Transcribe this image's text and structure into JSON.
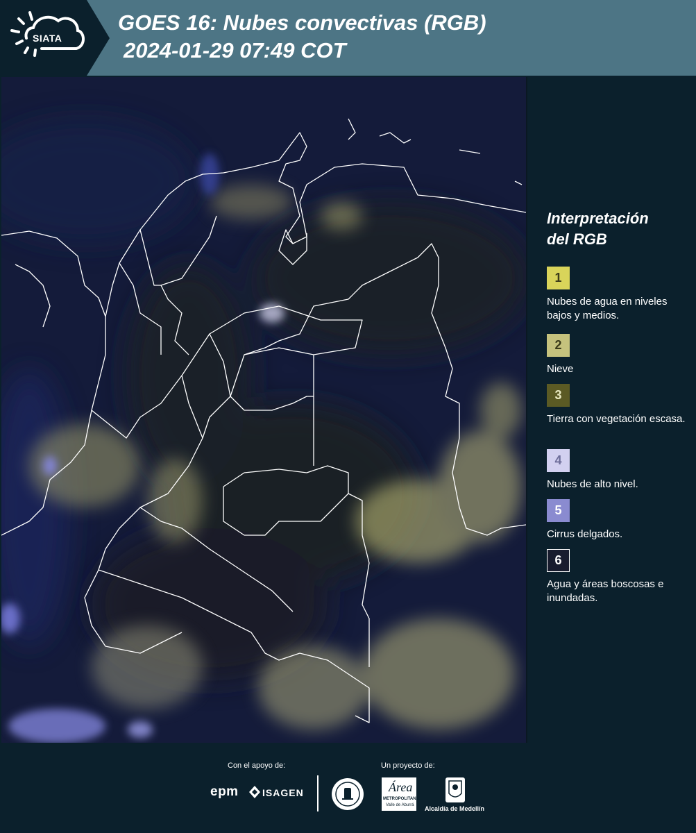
{
  "header": {
    "logo_text": "SIATA",
    "title": "GOES 16: Nubes convectivas (RGB)",
    "subtitle": "2024-01-29 07:49 COT"
  },
  "map": {
    "background_color": "#141b3a",
    "border_color": "#ffffff"
  },
  "legend": {
    "title_line1": "Interpretación",
    "title_line2": "del RGB",
    "entries": [
      {
        "number": "1",
        "label": "Nubes de agua en niveles bajos y medios.",
        "color": "#d9d45a",
        "text_color": "#3b3b1a"
      },
      {
        "number": "2",
        "label": "Nieve",
        "color": "#c5c27d",
        "text_color": "#3b3b1a"
      },
      {
        "number": "3",
        "label": "Tierra con vegetación escasa.",
        "color": "#5b5a24",
        "text_color": "#e8e8c0"
      },
      {
        "number": "4",
        "label": "Nubes de alto nivel.",
        "color": "#d2d0f0",
        "text_color": "#6e6e9a"
      },
      {
        "number": "5",
        "label": "Cirrus delgados.",
        "color": "#8a8bd0",
        "text_color": "#ffffff"
      },
      {
        "number": "6",
        "label": "Agua y áreas boscosas e inundadas.",
        "color": "#181c2e",
        "text_color": "#ffffff"
      }
    ]
  },
  "footer": {
    "support_label": "Con el apoyo de:",
    "project_label": "Un proyecto de:",
    "sponsors": [
      "epm",
      "ISAGEN"
    ],
    "partners": [
      "Área Metropolitana Valle de Aburrá",
      "Alcaldía de Medellín"
    ],
    "metropolitana_text": "METROPOLITANA",
    "valle_text": "Valle de Aburrá",
    "alcaldia_text": "Alcaldía de Medellín"
  }
}
